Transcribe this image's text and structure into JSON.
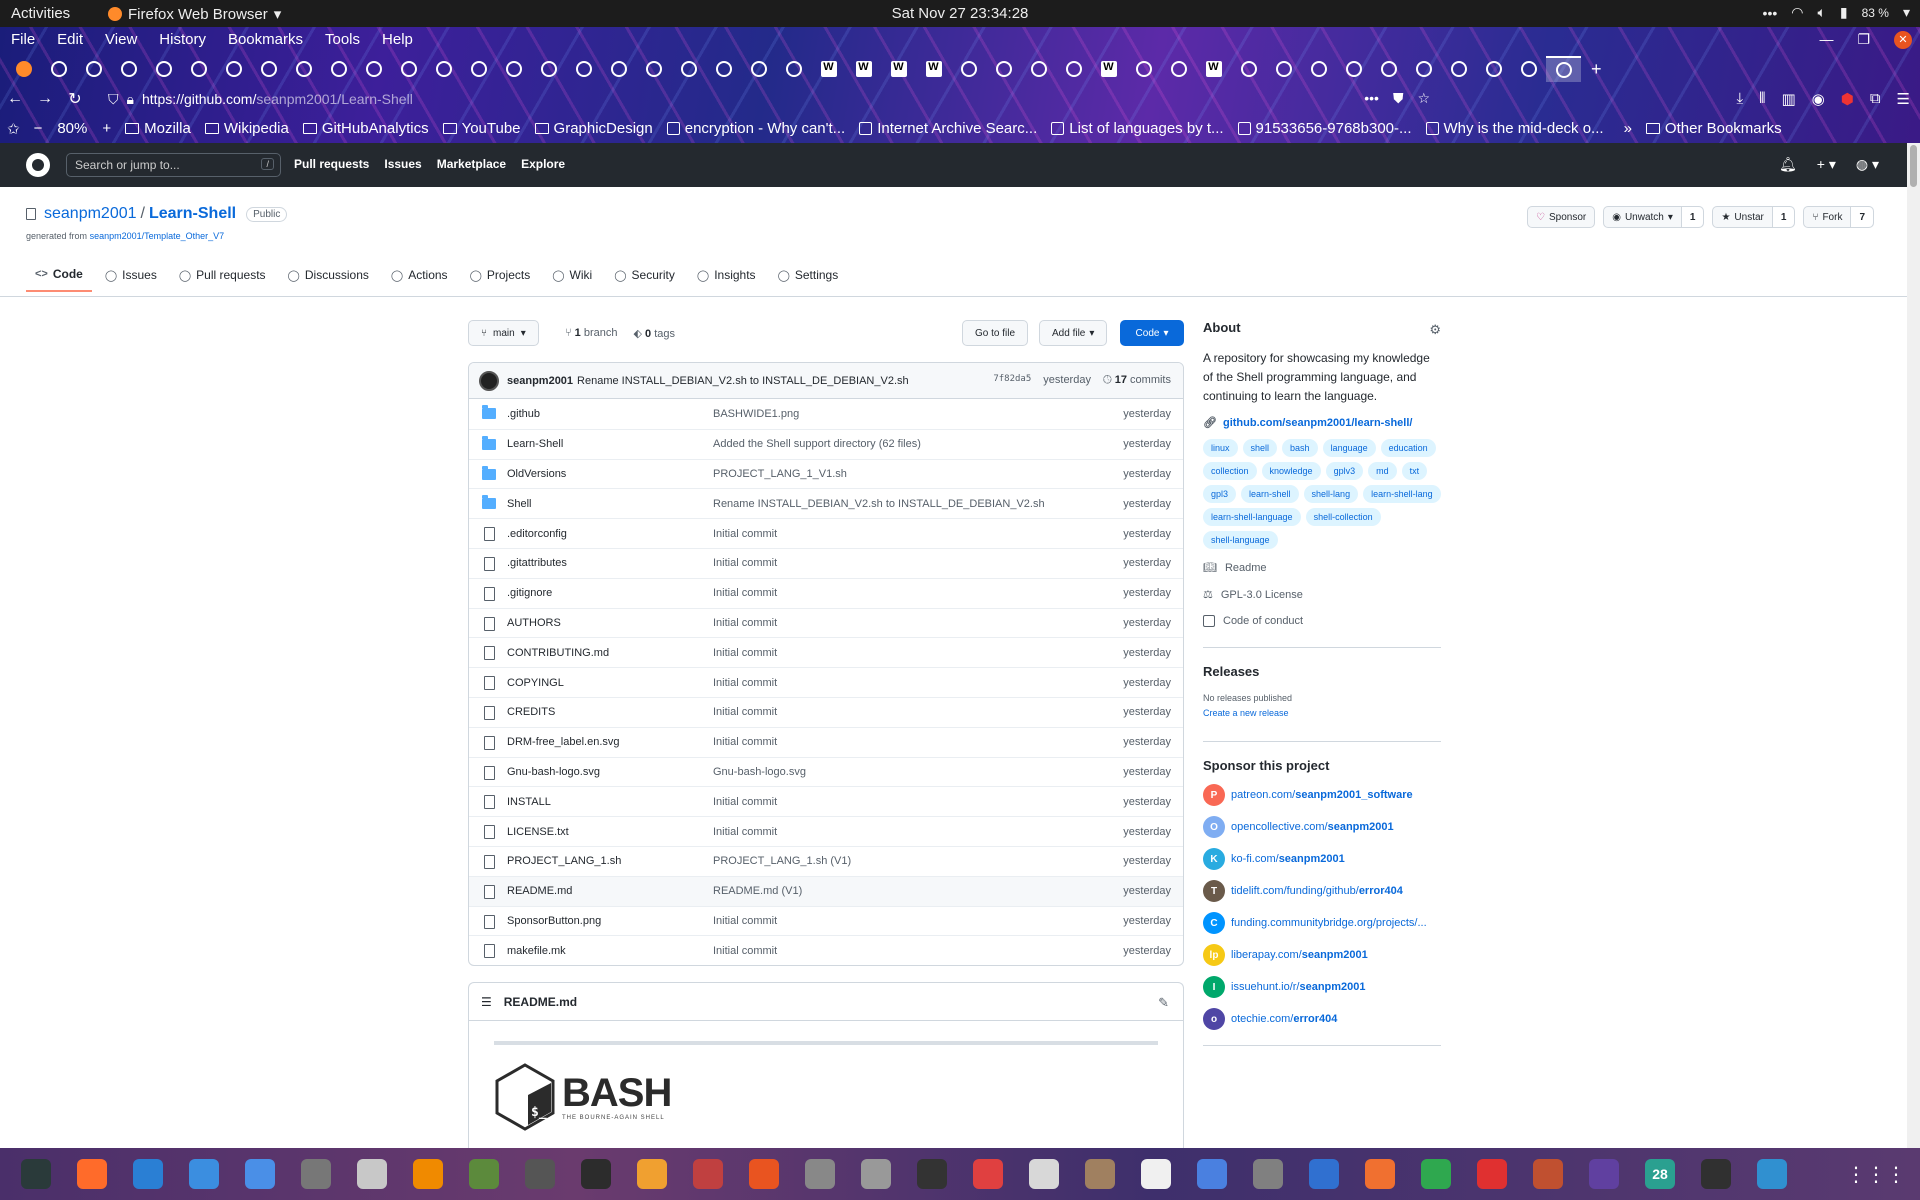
{
  "gnome": {
    "activities": "Activities",
    "app_name": "Firefox Web Browser",
    "clock": "Sat Nov 27  23:34:28",
    "battery": "83 %"
  },
  "firefox": {
    "menu": [
      "File",
      "Edit",
      "View",
      "History",
      "Bookmarks",
      "Tools",
      "Help"
    ],
    "url_host": "https://github.com/",
    "url_path": "seanpm2001/Learn-Shell",
    "zoom": "80%",
    "bookmarks": [
      {
        "label": "Mozilla",
        "icon": "folder-icon"
      },
      {
        "label": "Wikipedia",
        "icon": "folder-icon"
      },
      {
        "label": "GitHubAnalytics",
        "icon": "folder-icon"
      },
      {
        "label": "YouTube",
        "icon": "folder-icon"
      },
      {
        "label": "GraphicDesign",
        "icon": "folder-icon"
      },
      {
        "label": "encryption - Why can't...",
        "icon": "stackexchange-icon"
      },
      {
        "label": "Internet Archive Searc...",
        "icon": "archive-icon"
      },
      {
        "label": "List of languages by t...",
        "icon": "wikipedia-icon"
      },
      {
        "label": "91533656-9768b300-...",
        "icon": "globe-icon"
      },
      {
        "label": "Why is the mid-deck o...",
        "icon": "stackexchange-icon"
      }
    ],
    "other_bookmarks": "Other Bookmarks"
  },
  "github": {
    "search_placeholder": "Search or jump to...",
    "search_key": "/",
    "nav": [
      "Pull requests",
      "Issues",
      "Marketplace",
      "Explore"
    ]
  },
  "repo": {
    "owner": "seanpm2001",
    "separator": "/",
    "name": "Learn-Shell",
    "visibility": "Public",
    "generated_prefix": "generated from",
    "generated_link": "seanpm2001/Template_Other_V7",
    "sponsor_label": "Sponsor",
    "watch_label": "Unwatch",
    "watch_count": "1",
    "star_label": "Unstar",
    "star_count": "1",
    "fork_label": "Fork",
    "fork_count": "7",
    "tabs": [
      {
        "label": "Code",
        "icon": "code-icon"
      },
      {
        "label": "Issues",
        "icon": "issue-icon"
      },
      {
        "label": "Pull requests",
        "icon": "pull-request-icon"
      },
      {
        "label": "Discussions",
        "icon": "discussion-icon"
      },
      {
        "label": "Actions",
        "icon": "play-icon"
      },
      {
        "label": "Projects",
        "icon": "table-icon"
      },
      {
        "label": "Wiki",
        "icon": "book-icon"
      },
      {
        "label": "Security",
        "icon": "shield-icon"
      },
      {
        "label": "Insights",
        "icon": "graph-icon"
      },
      {
        "label": "Settings",
        "icon": "gear-icon"
      }
    ]
  },
  "files": {
    "branch": "main",
    "branches_count": "1",
    "branches_label": "branch",
    "tags_count": "0",
    "tags_label": "tags",
    "goto_file": "Go to file",
    "add_file": "Add file",
    "code": "Code",
    "commit_author": "seanpm2001",
    "commit_message": "Rename INSTALL_DEBIAN_V2.sh to INSTALL_DE_DEBIAN_V2.sh",
    "commit_sha": "7f82da5",
    "commit_age": "yesterday",
    "commit_count": "17",
    "commit_label": "commits",
    "rows": [
      {
        "type": "dir",
        "name": ".github",
        "message": "BASHWIDE1.png",
        "age": "yesterday"
      },
      {
        "type": "dir",
        "name": "Learn-Shell",
        "message": "Added the Shell support directory (62 files)",
        "age": "yesterday"
      },
      {
        "type": "dir",
        "name": "OldVersions",
        "message": "PROJECT_LANG_1_V1.sh",
        "age": "yesterday"
      },
      {
        "type": "dir",
        "name": "Shell",
        "message": "Rename INSTALL_DEBIAN_V2.sh to INSTALL_DE_DEBIAN_V2.sh",
        "age": "yesterday"
      },
      {
        "type": "file",
        "name": ".editorconfig",
        "message": "Initial commit",
        "age": "yesterday"
      },
      {
        "type": "file",
        "name": ".gitattributes",
        "message": "Initial commit",
        "age": "yesterday"
      },
      {
        "type": "file",
        "name": ".gitignore",
        "message": "Initial commit",
        "age": "yesterday"
      },
      {
        "type": "file",
        "name": "AUTHORS",
        "message": "Initial commit",
        "age": "yesterday"
      },
      {
        "type": "file",
        "name": "CONTRIBUTING.md",
        "message": "Initial commit",
        "age": "yesterday"
      },
      {
        "type": "file",
        "name": "COPYINGL",
        "message": "Initial commit",
        "age": "yesterday"
      },
      {
        "type": "file",
        "name": "CREDITS",
        "message": "Initial commit",
        "age": "yesterday"
      },
      {
        "type": "file",
        "name": "DRM-free_label.en.svg",
        "message": "Initial commit",
        "age": "yesterday"
      },
      {
        "type": "file",
        "name": "Gnu-bash-logo.svg",
        "message": "Gnu-bash-logo.svg",
        "age": "yesterday"
      },
      {
        "type": "file",
        "name": "INSTALL",
        "message": "Initial commit",
        "age": "yesterday"
      },
      {
        "type": "file",
        "name": "LICENSE.txt",
        "message": "Initial commit",
        "age": "yesterday"
      },
      {
        "type": "file",
        "name": "PROJECT_LANG_1.sh",
        "message": "PROJECT_LANG_1.sh (V1)",
        "age": "yesterday"
      },
      {
        "type": "file",
        "name": "README.md",
        "message": "README.md (V1)",
        "age": "yesterday"
      },
      {
        "type": "file",
        "name": "SponsorButton.png",
        "message": "Initial commit",
        "age": "yesterday"
      },
      {
        "type": "file",
        "name": "makefile.mk",
        "message": "Initial commit",
        "age": "yesterday"
      }
    ]
  },
  "readme": {
    "title": "README.md",
    "logo_word": "BASH",
    "logo_sub": "THE BOURNE-AGAIN SHELL",
    "logo_prompt": "$_"
  },
  "about": {
    "title": "About",
    "description": "A repository for showcasing my knowledge of the Shell programming language, and continuing to learn the language.",
    "link": "github.com/seanpm2001/learn-shell/",
    "topics": [
      "linux",
      "shell",
      "bash",
      "language",
      "education",
      "collection",
      "knowledge",
      "gplv3",
      "md",
      "txt",
      "gpl3",
      "learn-shell",
      "shell-lang",
      "learn-shell-lang",
      "learn-shell-language",
      "shell-collection",
      "shell-language"
    ],
    "readme": "Readme",
    "license": "GPL-3.0 License",
    "conduct": "Code of conduct"
  },
  "releases": {
    "title": "Releases",
    "none": "No releases published",
    "create": "Create a new release"
  },
  "sponsor": {
    "title": "Sponsor this project",
    "links": [
      {
        "prefix": "patreon.com/",
        "bold": "seanpm2001_software",
        "color": "#f96854",
        "glyph": "P"
      },
      {
        "prefix": "opencollective.com/",
        "bold": "seanpm2001",
        "color": "#7fadf2",
        "glyph": "O"
      },
      {
        "prefix": "ko-fi.com/",
        "bold": "seanpm2001",
        "color": "#29abe0",
        "glyph": "K"
      },
      {
        "prefix": "tidelift.com/funding/github/",
        "bold": "error404",
        "color": "#6a5a4a",
        "glyph": "T"
      },
      {
        "prefix": "funding.communitybridge.org/projects/...",
        "bold": "",
        "color": "#0094ff",
        "glyph": "C"
      },
      {
        "prefix": "liberapay.com/",
        "bold": "seanpm2001",
        "color": "#f6c915",
        "glyph": "lp"
      },
      {
        "prefix": "issuehunt.io/r/",
        "bold": "seanpm2001",
        "color": "#00a86b",
        "glyph": "I"
      },
      {
        "prefix": "otechie.com/",
        "bold": "error404",
        "color": "#4f46a5",
        "glyph": "o"
      }
    ]
  },
  "dock": {
    "apps": [
      {
        "icon": "system-monitor-icon",
        "color": "#2a3a3a"
      },
      {
        "icon": "firefox-icon",
        "color": "#ff6b2a"
      },
      {
        "icon": "writer-icon",
        "color": "#2a7fd4"
      },
      {
        "icon": "help-icon",
        "color": "#3b8ee0"
      },
      {
        "icon": "text-editor-icon",
        "color": "#4a8fe7"
      },
      {
        "icon": "settings-icon",
        "color": "#777777"
      },
      {
        "icon": "files-icon",
        "color": "#c8c8c8"
      },
      {
        "icon": "vlc-icon",
        "color": "#f08a00"
      },
      {
        "icon": "minecraft-icon",
        "color": "#5c8a3c"
      },
      {
        "icon": "software-icon",
        "color": "#555555"
      },
      {
        "icon": "terminal-icon",
        "color": "#2c2c2c"
      },
      {
        "icon": "calculator-icon",
        "color": "#f0a030"
      },
      {
        "icon": "audio-icon",
        "color": "#c04040"
      },
      {
        "icon": "store-icon",
        "color": "#e95420"
      },
      {
        "icon": "search-icon",
        "color": "#888888"
      },
      {
        "icon": "disk-icon",
        "color": "#999999"
      },
      {
        "icon": "inkscape-icon",
        "color": "#333333"
      },
      {
        "icon": "calendar-icon",
        "color": "#e04040"
      },
      {
        "icon": "font-viewer-icon",
        "color": "#d8d8d8"
      },
      {
        "icon": "archive-icon",
        "color": "#a08060"
      },
      {
        "icon": "document-icon",
        "color": "#f0f0f0"
      },
      {
        "icon": "tasks-icon",
        "color": "#4a80e0"
      },
      {
        "icon": "vim-icon",
        "color": "#808080"
      },
      {
        "icon": "chat-icon",
        "color": "#3070d0"
      },
      {
        "icon": "update-icon",
        "color": "#f07030"
      },
      {
        "icon": "spreadsheet-icon",
        "color": "#2fa84f"
      },
      {
        "icon": "alert-icon",
        "color": "#e03030"
      },
      {
        "icon": "game-icon",
        "color": "#c05030"
      },
      {
        "icon": "screenshot-icon",
        "color": "#6040a0"
      },
      {
        "icon": "calendar-day-icon",
        "color": "#2aa090"
      },
      {
        "icon": "music-icon",
        "color": "#303030"
      },
      {
        "icon": "photos-icon",
        "color": "#3090d0"
      }
    ],
    "calendar_day": "28"
  }
}
